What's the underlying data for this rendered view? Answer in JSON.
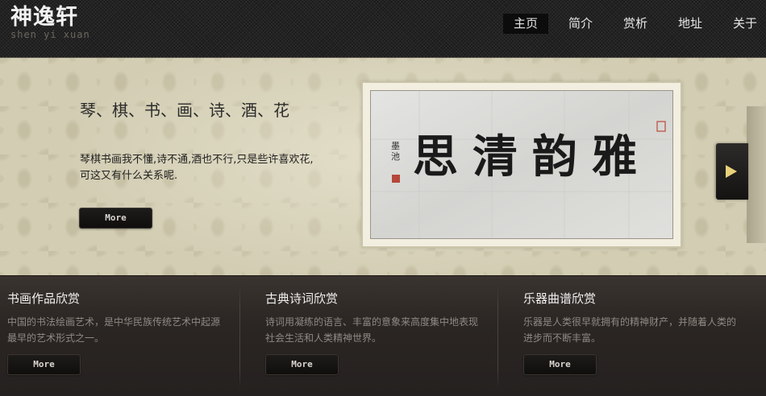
{
  "logo": {
    "title": "神逸轩",
    "subtitle": "shen yi xuan"
  },
  "nav": {
    "items": [
      {
        "label": "主页",
        "active": true
      },
      {
        "label": "简介",
        "active": false
      },
      {
        "label": "赏析",
        "active": false
      },
      {
        "label": "地址",
        "active": false
      },
      {
        "label": "关于",
        "active": false
      }
    ]
  },
  "hero": {
    "title": "琴、棋、书、画、诗、酒、花",
    "description": "琴棋书画我不懂,诗不通,酒也不行,只是些许喜欢花,可这又有什么关系呢.",
    "button_label": "More",
    "artwork": {
      "main_characters": "雅韵清思",
      "signature": "墨池"
    },
    "next_icon": "triangle-right-icon"
  },
  "columns": [
    {
      "title": "书画作品欣赏",
      "description": "中国的书法绘画艺术，是中华民族传统艺术中起源最早的艺术形式之一。",
      "button_label": "More"
    },
    {
      "title": "古典诗词欣赏",
      "description": "诗词用凝练的语言、丰富的意象来高度集中地表现社会生活和人类精神世界。",
      "button_label": "More"
    },
    {
      "title": "乐器曲谱欣赏",
      "description": "乐器是人类很早就拥有的精神财产，并随着人类的进步而不断丰富。",
      "button_label": "More"
    }
  ],
  "colors": {
    "header_bg": "#1b1b1b",
    "hero_bg": "#d2cdb3",
    "bottom_bg": "#2b2623",
    "button_bg": "#141312",
    "arrow_accent": "#e8d17a"
  }
}
